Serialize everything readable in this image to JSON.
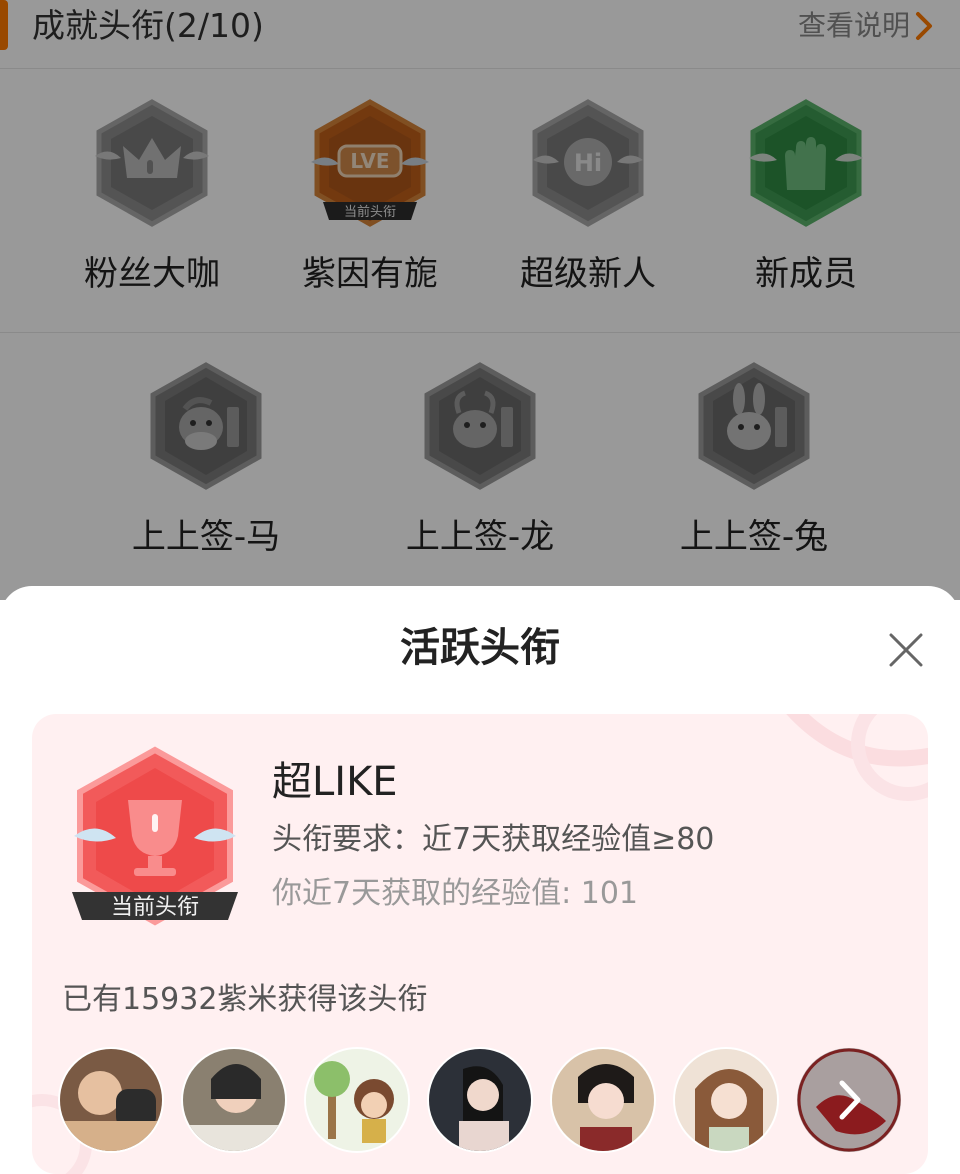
{
  "header": {
    "title": "成就头衔(2/10)",
    "link_label": "查看说明",
    "accent_color": "#ff7a00"
  },
  "badges_row1": [
    {
      "label": "粉丝大咖",
      "icon": "crown-badge-icon",
      "state": "locked"
    },
    {
      "label": "紫因有旎",
      "icon": "lve-badge-icon",
      "state": "current",
      "tag": "当前头衔"
    },
    {
      "label": "超级新人",
      "icon": "hi-badge-icon",
      "state": "locked"
    },
    {
      "label": "新成员",
      "icon": "hand-badge-icon",
      "state": "unlocked"
    }
  ],
  "badges_row2": [
    {
      "label": "上上签-马",
      "icon": "horse-badge-icon",
      "state": "locked"
    },
    {
      "label": "上上签-龙",
      "icon": "dragon-badge-icon",
      "state": "locked"
    },
    {
      "label": "上上签-兔",
      "icon": "rabbit-badge-icon",
      "state": "locked"
    }
  ],
  "sheet": {
    "title": "活跃头衔",
    "badge_name": "超LIKE",
    "badge_icon": "trophy-badge-icon",
    "current_tag": "当前头衔",
    "requirement": "头衔要求：近7天获取经验值≥80",
    "my_value": "你近7天获取的经验值: 101",
    "owners_count": "已有15932紫米获得该头衔",
    "accent_color": "#f04848"
  }
}
